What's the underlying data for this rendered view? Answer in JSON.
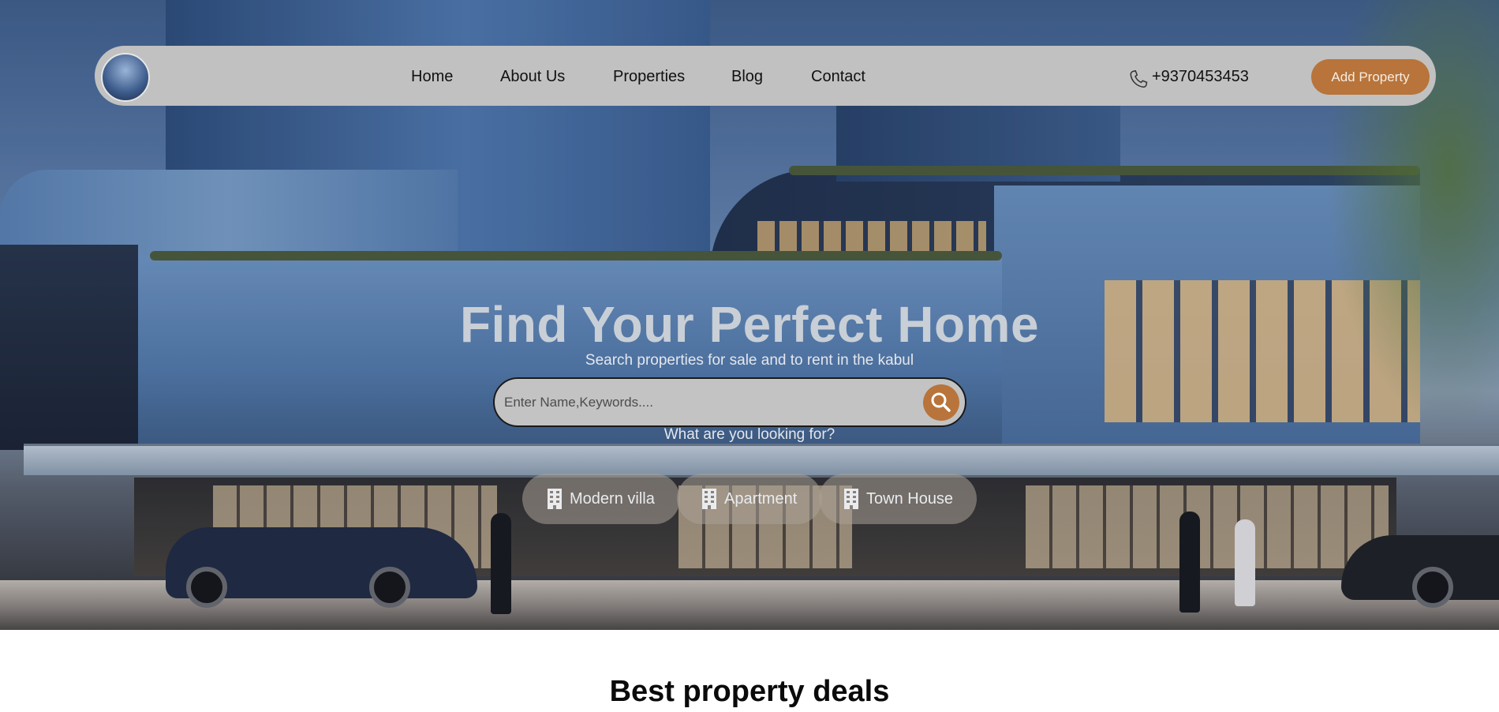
{
  "nav": {
    "logo_icon": "building-logo-icon",
    "links": [
      "Home",
      "About Us",
      "Properties",
      "Blog",
      "Contact"
    ],
    "phone_icon": "phone-icon",
    "phone": "+9370453453",
    "add_property": "Add Property"
  },
  "hero": {
    "title": "Find Your Perfect Home",
    "subtitle": "Search properties for sale and to rent in the kabul",
    "search_placeholder": "Enter Name,Keywords....",
    "search_icon": "search-icon",
    "question": "What are you looking for?",
    "categories": [
      {
        "label": "Modern villa",
        "icon": "building-icon"
      },
      {
        "label": "Apartment",
        "icon": "building-icon"
      },
      {
        "label": "Town House",
        "icon": "building-icon"
      }
    ]
  },
  "section": {
    "title": "Best property deals"
  },
  "colors": {
    "accent": "#b8743a",
    "navbar": "#c1c1c1"
  }
}
